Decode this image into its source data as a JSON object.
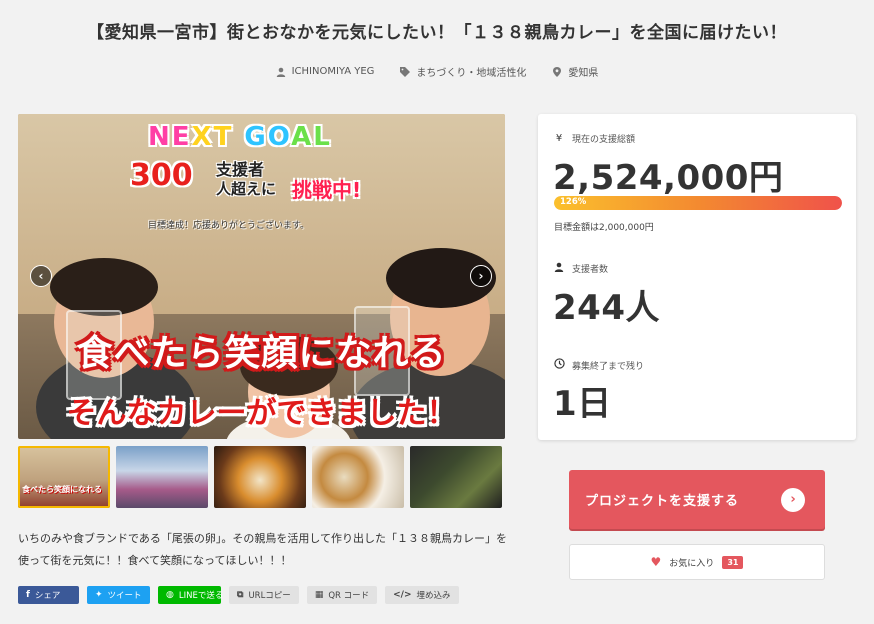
{
  "project": {
    "title": "【愛知県一宮市】街とおなかを元気にしたい！「１３８親鳥カレー」を全国に届けたい！",
    "owner": "ICHINOMIYA YEG",
    "category": "まちづくり・地域活性化",
    "region": "愛知県"
  },
  "hero": {
    "goal_word_1": "NE",
    "goal_word_2": "XT ",
    "goal_word_3": "GO",
    "goal_word_4": "AL",
    "goal_number": "300",
    "goal_supporters": "支援者",
    "goal_over": "人超えに",
    "goal_challenge": "挑戦中!",
    "goal_thanks": "目標達成！応援ありがとうございます。",
    "caption_line1": "食べたら笑顔になれる",
    "caption_line2": "そんなカレーができました！",
    "prev_arrow": "‹",
    "next_arrow": "›"
  },
  "thumbnails": {
    "t1_caption": "食べたら笑顔になれる"
  },
  "description": "いちのみや食ブランドである「尾張の卵」。その親鳥を活用して作り出した「１３８親鳥カレー」を使って街を元気に！！食べて笑顔になってほしい！！！",
  "share": {
    "facebook": "シェア",
    "twitter": "ツイート",
    "line": "LINEで送る",
    "url_copy": "URLコピー",
    "qr_code": "QR コード",
    "embed": "埋め込み"
  },
  "stats": {
    "total_label": "現在の支援総額",
    "total_amount": "2,524,000円",
    "progress_text": "126%",
    "progress_percent": 126,
    "target_text": "目標金額は2,000,000円",
    "supporters_label": "支援者数",
    "supporters_value": "244人",
    "remaining_label": "募集終了まで残り",
    "remaining_value": "1日"
  },
  "actions": {
    "support_label": "プロジェクトを支援する",
    "favorite_label": "お気に入り",
    "favorite_count": "31"
  },
  "colors": {
    "accent": "#e4575e",
    "progress_start": "#fbc02d",
    "progress_end": "#f0524a",
    "facebook": "#3b5998",
    "twitter": "#1da1f2",
    "line": "#00b900"
  }
}
